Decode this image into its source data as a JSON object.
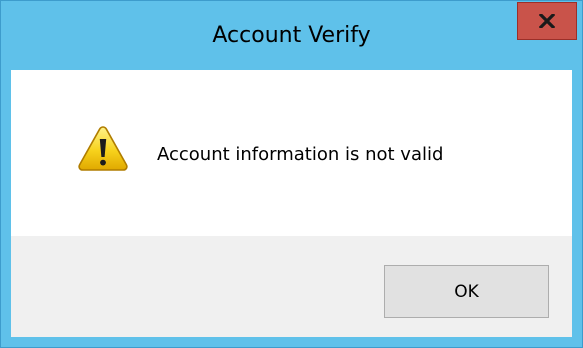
{
  "window": {
    "title": "Account Verify",
    "accent_color": "#5fc1ea",
    "close_button_color": "#c9534a"
  },
  "dialog": {
    "icon": "warning-icon",
    "message": "Account information is not valid"
  },
  "buttons": {
    "ok_label": "OK"
  }
}
